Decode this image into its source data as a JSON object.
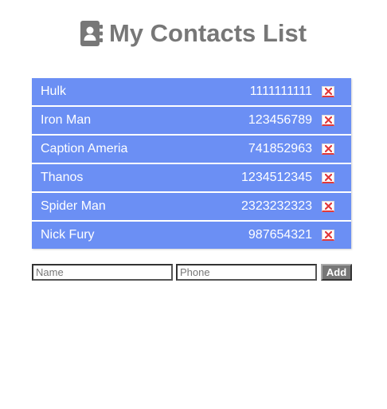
{
  "header": {
    "title": "My Contacts List",
    "icon": "address-book-icon",
    "title_color": "#777777"
  },
  "contacts": [
    {
      "name": "Hulk",
      "phone": "1111111111"
    },
    {
      "name": "Iron Man",
      "phone": "123456789"
    },
    {
      "name": "Caption Ameria",
      "phone": "741852963"
    },
    {
      "name": "Thanos",
      "phone": "1234512345"
    },
    {
      "name": "Spider Man",
      "phone": "2323232323"
    },
    {
      "name": "Nick Fury",
      "phone": "987654321"
    }
  ],
  "list_style": {
    "row_background": "#6b8ff4",
    "text_color": "#ffffff",
    "delete_icon": "close-icon",
    "delete_color": "#e23a3a"
  },
  "form": {
    "name_placeholder": "Name",
    "name_value": "",
    "phone_placeholder": "Phone",
    "phone_value": "",
    "add_label": "Add",
    "add_background": "#777777"
  }
}
